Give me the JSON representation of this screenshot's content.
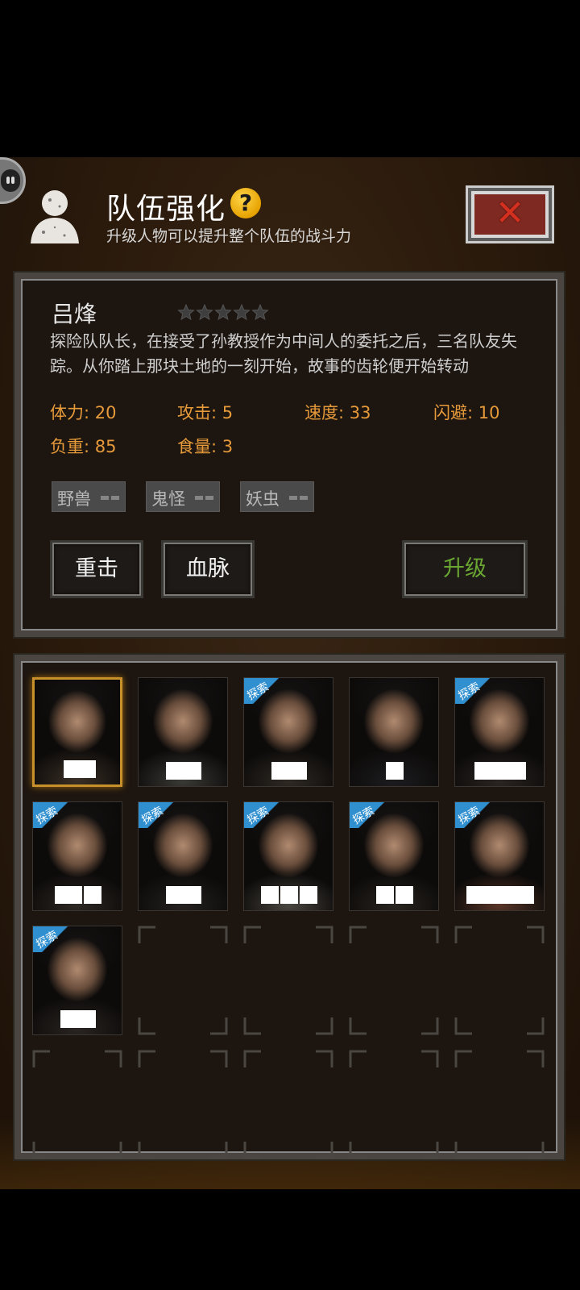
{
  "header": {
    "title": "队伍强化",
    "help_glyph": "?",
    "subtitle": "升级人物可以提升整个队伍的战斗力",
    "close_glyph": "✕"
  },
  "character": {
    "name": "吕烽",
    "stars": 5,
    "stars_filled": 0,
    "description": "探险队队长，在接受了孙教授作为中间人的委托之后，三名队友失踪。从你踏上那块土地的一刻开始，故事的齿轮便开始转动",
    "stats": [
      {
        "label": "体力: 20"
      },
      {
        "label": "攻击: 5"
      },
      {
        "label": "速度: 33"
      },
      {
        "label": "闪避: 10"
      },
      {
        "label": "负重: 85"
      },
      {
        "label": "食量: 3"
      }
    ],
    "tags": [
      {
        "label": "野兽"
      },
      {
        "label": "鬼怪"
      },
      {
        "label": "妖虫"
      }
    ]
  },
  "actions": {
    "skill_1": "重击",
    "skill_2": "血脉",
    "upgrade": "升级"
  },
  "roster": {
    "explore_tag": "探索",
    "slots": [
      {
        "explore": false,
        "selected": true
      },
      {
        "explore": false,
        "selected": false
      },
      {
        "explore": true,
        "selected": false
      },
      {
        "explore": false,
        "selected": false
      },
      {
        "explore": true,
        "selected": false
      },
      {
        "explore": true,
        "selected": false
      },
      {
        "explore": true,
        "selected": false
      },
      {
        "explore": true,
        "selected": false
      },
      {
        "explore": true,
        "selected": false
      },
      {
        "explore": true,
        "selected": false
      },
      {
        "explore": true,
        "selected": false
      }
    ],
    "empty_slots": 9
  },
  "colors": {
    "stat_text": "#e69a3a",
    "upgrade_text": "#6aa632",
    "selected_border": "#c8902a",
    "explore_ribbon": "#2f8fcf",
    "close_red": "#d4301f"
  }
}
